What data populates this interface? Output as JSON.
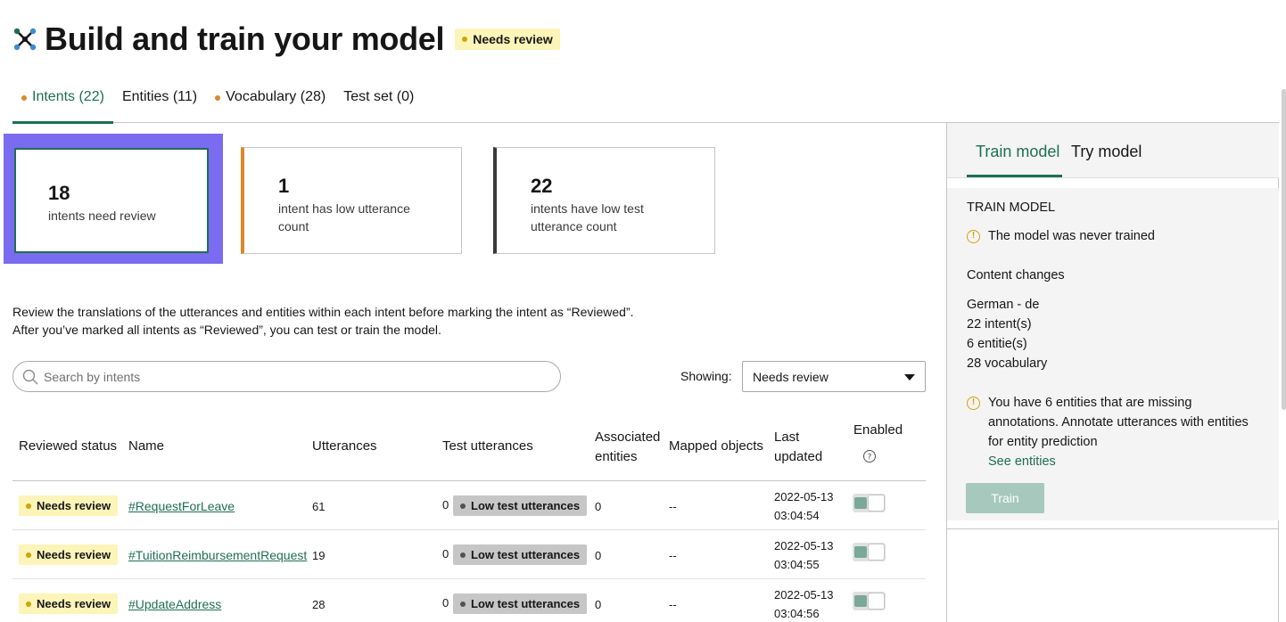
{
  "header": {
    "title": "Build and train your model",
    "badge": "Needs review",
    "logo_icon": "network-icon"
  },
  "tabs": [
    {
      "label": "Intents (22)",
      "active": true,
      "dot": true
    },
    {
      "label": "Entities (11)",
      "active": false,
      "dot": false
    },
    {
      "label": "Vocabulary (28)",
      "active": false,
      "dot": true
    },
    {
      "label": "Test set (0)",
      "active": false,
      "dot": false
    }
  ],
  "cards": [
    {
      "number": "18",
      "text": "intents need review"
    },
    {
      "number": "1",
      "text": "intent has low utterance count"
    },
    {
      "number": "22",
      "text": "intents have low test utterance count"
    }
  ],
  "info": {
    "line1": "Review the translations of the utterances and entities within each intent before marking the intent as “Reviewed”.",
    "line2": "After you’ve marked all intents as “Reviewed”, you can test or train the model."
  },
  "search": {
    "placeholder": "Search by intents"
  },
  "filter": {
    "label": "Showing:",
    "selected": "Needs review"
  },
  "table": {
    "columns": {
      "reviewed_status": "Reviewed status",
      "name": "Name",
      "utterances": "Utterances",
      "test_utterances": "Test utterances",
      "associated_entities_1": "Associated",
      "associated_entities_2": "entities",
      "mapped_objects": "Mapped objects",
      "last_updated_1": "Last",
      "last_updated_2": "updated",
      "enabled": "Enabled"
    },
    "rows": [
      {
        "status": "Needs review",
        "name": "#RequestForLeave",
        "utterances": "61",
        "test_count": "0",
        "test_badge": "Low test utterances",
        "entities": "0",
        "mapped": "--",
        "date": "2022-05-13",
        "time": "03:04:54",
        "enabled": true
      },
      {
        "status": "Needs review",
        "name": "#TuitionReimbursementRequest",
        "utterances": "19",
        "test_count": "0",
        "test_badge": "Low test utterances",
        "entities": "0",
        "mapped": "--",
        "date": "2022-05-13",
        "time": "03:04:55",
        "enabled": true
      },
      {
        "status": "Needs review",
        "name": "#UpdateAddress",
        "utterances": "28",
        "test_count": "0",
        "test_badge": "Low test utterances",
        "entities": "0",
        "mapped": "--",
        "date": "2022-05-13",
        "time": "03:04:56",
        "enabled": true
      }
    ]
  },
  "panel": {
    "tabs": [
      "Train model",
      "Try model"
    ],
    "section_title": "TRAIN MODEL",
    "warning_1": "The model was never trained",
    "content_changes": "Content changes",
    "changes": [
      "German - de",
      "22 intent(s)",
      "6 entitie(s)",
      "28 vocabulary"
    ],
    "warning_2_lines": [
      "You have 6 entities that are missing",
      "annotations. Annotate utterances with entities",
      "for entity prediction"
    ],
    "see_entities": "See entities",
    "train_button": "Train"
  },
  "colors": {
    "accent": "#1e6e54",
    "badge_yellow": "#fcf4b8",
    "warning_orange": "#d98a2b",
    "highlight": "#7a6bf0"
  }
}
